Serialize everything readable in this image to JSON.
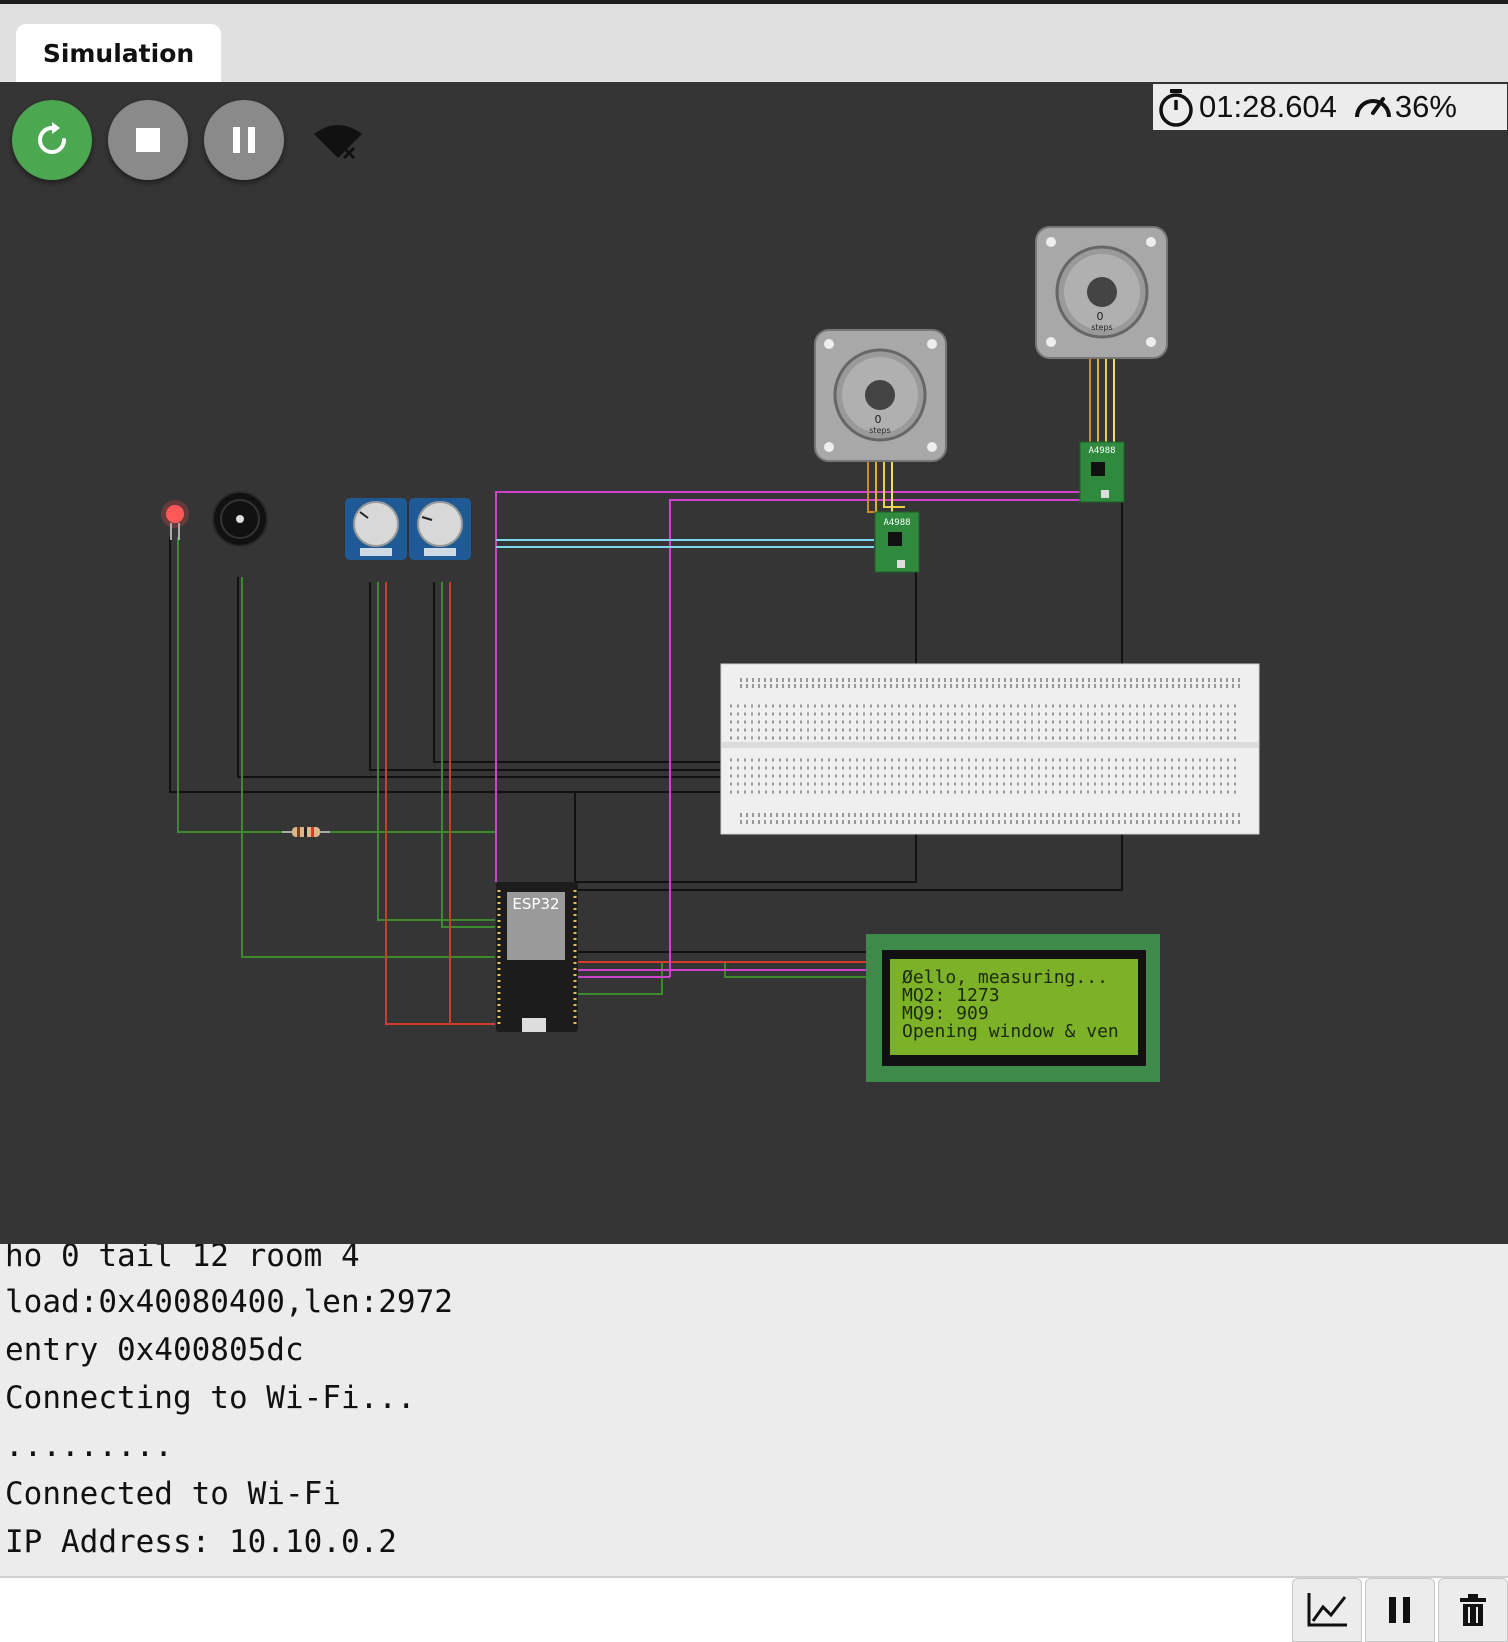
{
  "tab": {
    "label": "Simulation"
  },
  "controls": {
    "restart_icon": "restart-icon",
    "stop_icon": "stop-icon",
    "pause_icon": "pause-icon",
    "wifi_icon": "wifi-off-icon"
  },
  "status": {
    "timer": "01:28.604",
    "speed": "36%"
  },
  "components": {
    "stepper1": {
      "value": "0",
      "unit": "steps"
    },
    "stepper2": {
      "value": "0",
      "unit": "steps"
    },
    "driver1_label": "A4988",
    "driver2_label": "A4988",
    "esp32_label": "ESP32",
    "lcd_lines": [
      "Øello, measuring...",
      "MQ2: 1273",
      "MQ9: 909",
      "Opening window & ven"
    ]
  },
  "console": {
    "lines": [
      "ho 0 tail 12 room 4",
      "load:0x40080400,len:2972",
      "entry 0x400805dc",
      "Connecting to Wi-Fi...",
      ".........",
      "Connected to Wi-Fi",
      "IP Address: 10.10.0.2"
    ]
  },
  "input": {
    "value": "",
    "placeholder": ""
  },
  "toolbar": {
    "plotter_icon": "chart-icon",
    "pause_icon": "pause-icon",
    "clear_icon": "trash-icon"
  },
  "colors": {
    "canvas_bg": "#353535",
    "run_green": "#4ca850",
    "lcd_green": "#7db127"
  }
}
